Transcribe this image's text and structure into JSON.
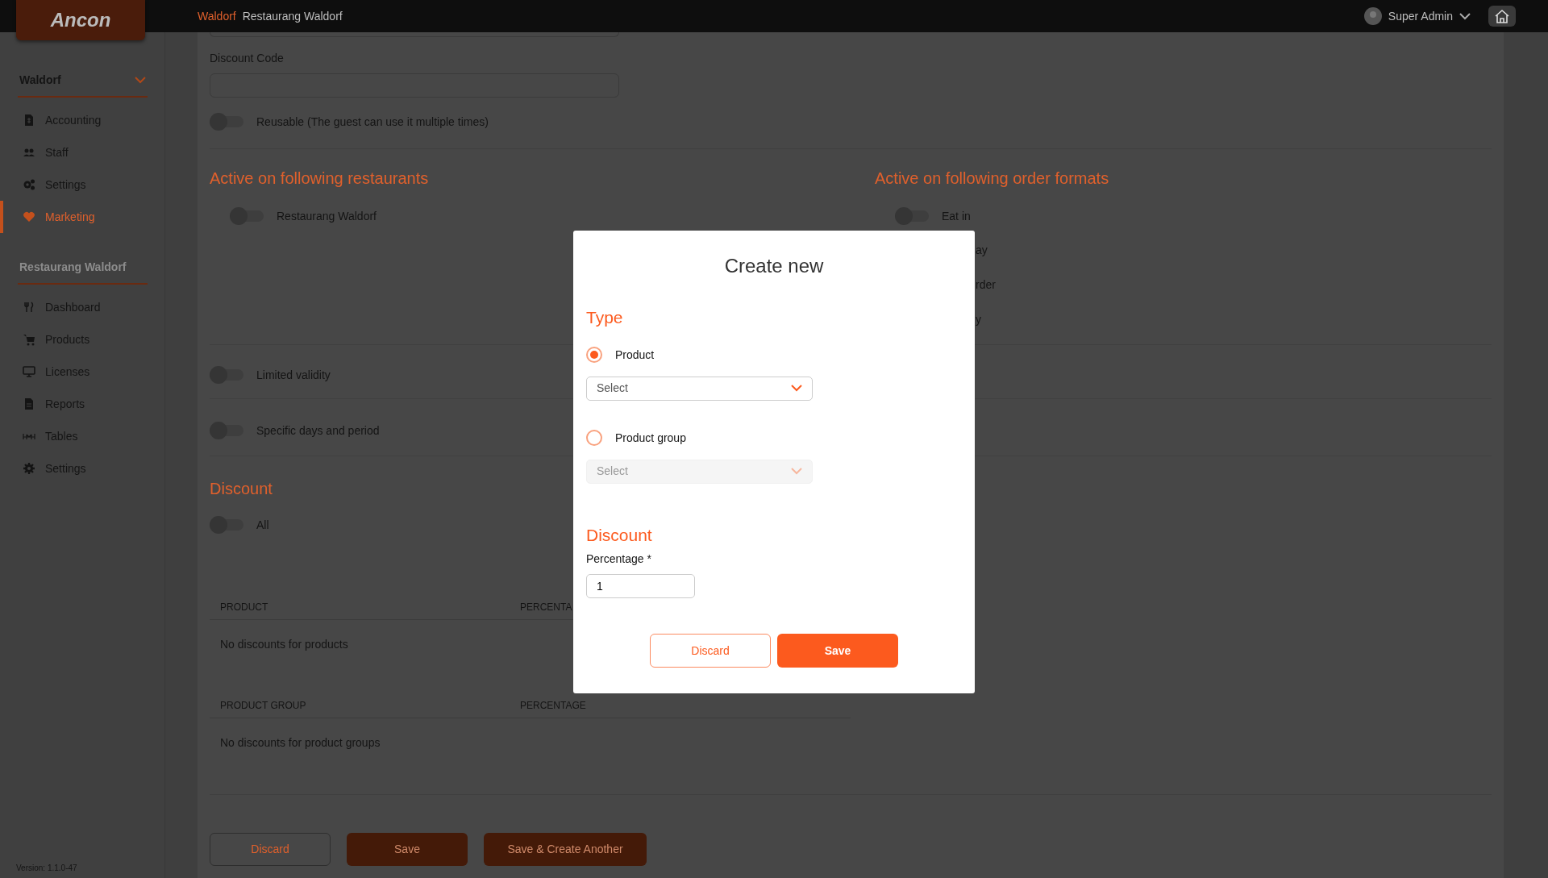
{
  "header": {
    "logo": "Ancon",
    "breadcrumbs": [
      {
        "label": "Waldorf",
        "current": false
      },
      {
        "label": "Restaurang Waldorf",
        "current": true
      }
    ],
    "user": "Super Admin"
  },
  "sidebar": {
    "sections": [
      {
        "title": "Waldorf",
        "kind": "dropdown",
        "items": [
          {
            "label": "Accounting",
            "selected": false
          },
          {
            "label": "Staff",
            "selected": false
          },
          {
            "label": "Settings",
            "selected": false
          },
          {
            "label": "Marketing",
            "selected": true
          }
        ]
      },
      {
        "title": "Restaurang Waldorf",
        "kind": "heading",
        "items": [
          {
            "label": "Dashboard",
            "selected": false
          },
          {
            "label": "Products",
            "selected": false
          },
          {
            "label": "Licenses",
            "selected": false
          },
          {
            "label": "Reports",
            "selected": false
          },
          {
            "label": "Tables",
            "selected": false
          },
          {
            "label": "Settings",
            "selected": false
          }
        ]
      }
    ],
    "version": "Version: 1.1.0-47"
  },
  "form": {
    "discount_code": {
      "label": "Discount Code"
    },
    "reusable": {
      "label": "Reusable (The guest can use it multiple times)",
      "on": false
    },
    "restaurants": {
      "title": "Active on following restaurants",
      "items": [
        {
          "label": "Restaurang Waldorf",
          "on": false
        }
      ]
    },
    "order_formats": {
      "title": "Active on following order formats",
      "items": [
        {
          "label": "Eat in",
          "on": false,
          "kind": "full"
        },
        {
          "label": "ay",
          "kind": "cut"
        },
        {
          "label": "rder",
          "kind": "cut"
        },
        {
          "label": "y",
          "kind": "cut"
        }
      ]
    },
    "limited_validity": {
      "label": "Limited validity",
      "on": false
    },
    "specific_days": {
      "label": "Specific days and period",
      "on": false
    },
    "discount": {
      "title": "Discount",
      "all": {
        "label": "All",
        "on": false
      },
      "tables": [
        {
          "columns": [
            "PRODUCT",
            "PERCENTA"
          ],
          "empty": "No discounts for products"
        },
        {
          "columns": [
            "PRODUCT GROUP",
            "PERCENTAGE"
          ],
          "empty": "No discounts for product groups"
        }
      ]
    },
    "buttons": [
      {
        "label": "Discard",
        "kind": "outline"
      },
      {
        "label": "Save",
        "kind": "fill"
      },
      {
        "label": "Save & Create Another",
        "kind": "fill"
      }
    ]
  },
  "modal": {
    "title": "Create new",
    "type_title": "Type",
    "options": [
      {
        "label": "Product",
        "selected": true,
        "select_placeholder": "Select"
      },
      {
        "label": "Product group",
        "selected": false,
        "select_placeholder": "Select"
      }
    ],
    "discount_title": "Discount",
    "percentage_label": "Percentage *",
    "percentage_value": "1",
    "buttons": [
      {
        "label": "Discard",
        "kind": "outline"
      },
      {
        "label": "Save",
        "kind": "fill"
      }
    ]
  }
}
